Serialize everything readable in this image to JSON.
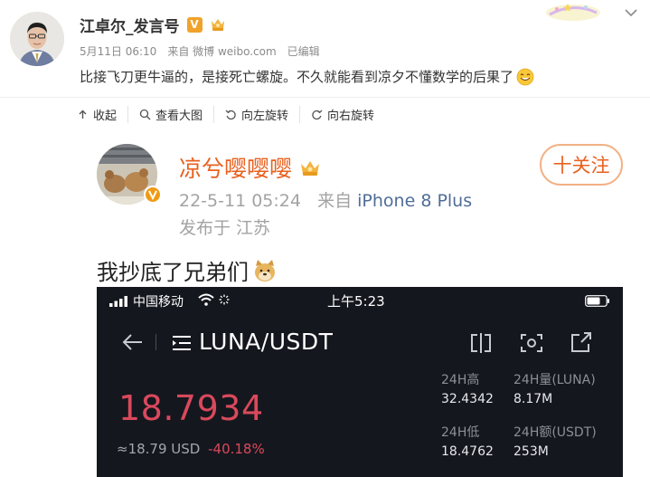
{
  "post": {
    "author": "江卓尔_发言号",
    "v_badge": "V",
    "date": "5月11日 06:10",
    "source": "来自 微博 weibo.com",
    "edited": "已编辑",
    "text": "比接飞刀更牛逼的，是接死亡螺旋。不久就能看到凉夕不懂数学的后果了"
  },
  "toolbar": [
    {
      "label": "收起",
      "icon": "collapse-icon"
    },
    {
      "label": "查看大图",
      "icon": "magnifier-icon"
    },
    {
      "label": "向左旋转",
      "icon": "rotate-left-icon"
    },
    {
      "label": "向右旋转",
      "icon": "rotate-right-icon"
    }
  ],
  "embedded": {
    "name": "凉兮嘤嘤嘤",
    "time": "22-5-11 05:24",
    "source_prefix": "来自",
    "source_device": "iPhone 8 Plus",
    "location": "发布于 江苏",
    "follow": "十关注",
    "post_text": "我抄底了兄弟们"
  },
  "phone": {
    "carrier": "中国移动",
    "time": "上午5:23",
    "pair": "LUNA/USDT",
    "price": "18.7934",
    "usd_price": "≈18.79 USD",
    "change": "-40.18%",
    "stats": {
      "high_label": "24H高",
      "high_value": "32.4342",
      "vol_label": "24H量(LUNA)",
      "vol_value": "8.17M",
      "low_label": "24H低",
      "low_value": "18.4762",
      "amount_label": "24H额(USDT)",
      "amount_value": "253M"
    },
    "price_color": "#d9495c",
    "background": "#15171e"
  },
  "colors": {
    "name_orange": "#e8611f",
    "link_blue": "#506d98",
    "badge_orange": "#f0a22a"
  }
}
